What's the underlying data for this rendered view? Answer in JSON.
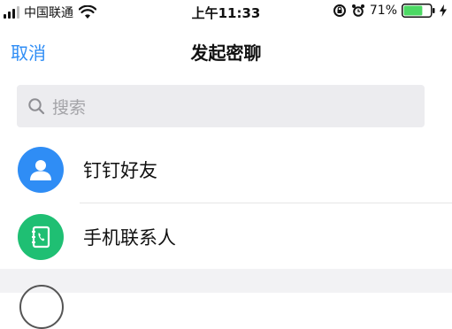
{
  "status_bar": {
    "carrier": "中国联通",
    "time": "上午11:33",
    "battery_percent": "71%",
    "battery_level": 0.71,
    "signal_bars": 3,
    "icons": [
      "signal-icon",
      "wifi-icon",
      "rotation-lock-icon",
      "alarm-icon",
      "battery-icon",
      "charging-bolt-icon"
    ]
  },
  "nav": {
    "cancel_label": "取消",
    "title": "发起密聊"
  },
  "search": {
    "placeholder": "搜索"
  },
  "list": [
    {
      "label": "钉钉好友",
      "icon": "person-icon",
      "color": "#2f8df5"
    },
    {
      "label": "手机联系人",
      "icon": "phone-contacts-icon",
      "color": "#1fbf73"
    }
  ],
  "colors": {
    "accent": "#2f8df5",
    "battery_green": "#4cd964"
  }
}
